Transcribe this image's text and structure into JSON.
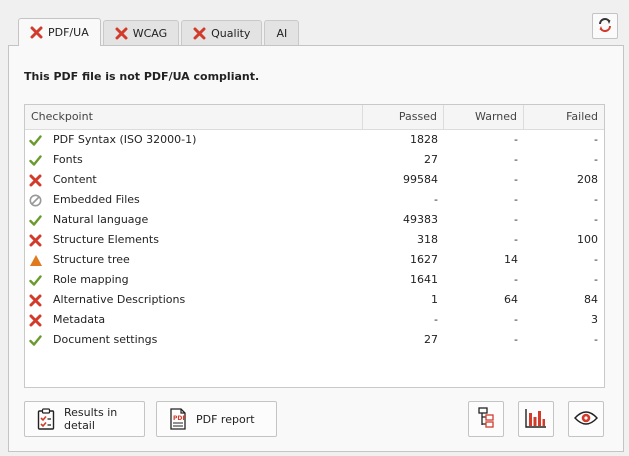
{
  "tabs": [
    {
      "label": "PDF/UA",
      "status": "fail"
    },
    {
      "label": "WCAG",
      "status": "fail"
    },
    {
      "label": "Quality",
      "status": "fail"
    },
    {
      "label": "AI",
      "status": "none"
    }
  ],
  "status_message": "This PDF file is not PDF/UA compliant.",
  "table": {
    "headers": [
      "Checkpoint",
      "Passed",
      "Warned",
      "Failed"
    ],
    "rows": [
      {
        "icon": "check-icon",
        "name": "PDF Syntax (ISO 32000-1)",
        "passed": "1828",
        "warned": "-",
        "failed": "-"
      },
      {
        "icon": "check-icon",
        "name": "Fonts",
        "passed": "27",
        "warned": "-",
        "failed": "-"
      },
      {
        "icon": "cross-icon",
        "name": "Content",
        "passed": "99584",
        "warned": "-",
        "failed": "208"
      },
      {
        "icon": "not-applicable-icon",
        "name": "Embedded Files",
        "passed": "-",
        "warned": "-",
        "failed": "-"
      },
      {
        "icon": "check-icon",
        "name": "Natural language",
        "passed": "49383",
        "warned": "-",
        "failed": "-"
      },
      {
        "icon": "cross-icon",
        "name": "Structure Elements",
        "passed": "318",
        "warned": "-",
        "failed": "100"
      },
      {
        "icon": "warning-icon",
        "name": "Structure tree",
        "passed": "1627",
        "warned": "14",
        "failed": "-"
      },
      {
        "icon": "check-icon",
        "name": "Role mapping",
        "passed": "1641",
        "warned": "-",
        "failed": "-"
      },
      {
        "icon": "cross-icon",
        "name": "Alternative Descriptions",
        "passed": "1",
        "warned": "64",
        "failed": "84"
      },
      {
        "icon": "cross-icon",
        "name": "Metadata",
        "passed": "-",
        "warned": "-",
        "failed": "3"
      },
      {
        "icon": "check-icon",
        "name": "Document settings",
        "passed": "27",
        "warned": "-",
        "failed": "-"
      }
    ]
  },
  "buttons": {
    "results_detail": "Results in detail",
    "pdf_report": "PDF report",
    "icons": [
      "structure-tree-icon",
      "bar-chart-icon",
      "eye-icon"
    ]
  },
  "refresh_icon": "refresh-icon",
  "colors": {
    "pass": "#6a9a2e",
    "fail": "#d23b2b",
    "warn": "#e07a1f",
    "na": "#999999"
  }
}
